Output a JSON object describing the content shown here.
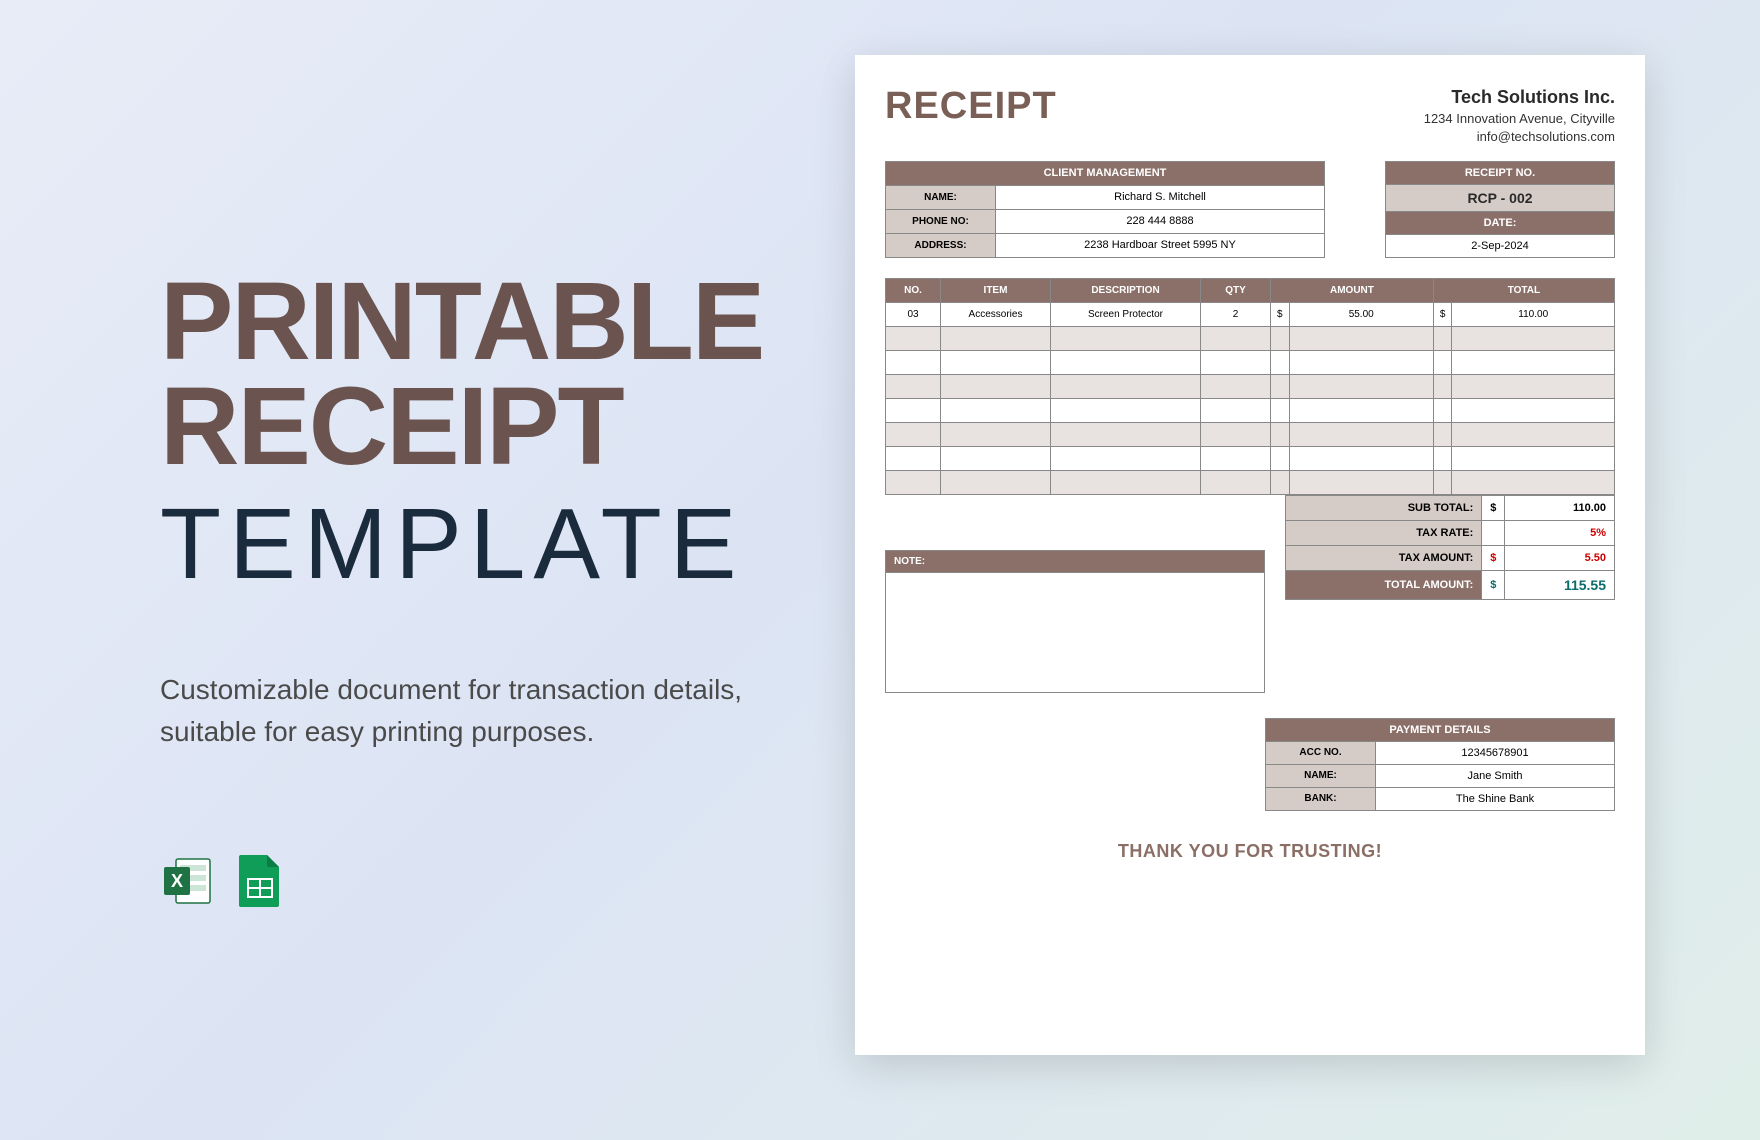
{
  "promo": {
    "title_line1": "PRINTABLE",
    "title_line2": "RECEIPT",
    "title_line3": "TEMPLATE",
    "subtitle": "Customizable document for transaction details, suitable for easy printing purposes."
  },
  "formats": {
    "excel": "Excel",
    "sheets": "Google Sheets"
  },
  "receipt": {
    "heading": "RECEIPT",
    "company": {
      "name": "Tech Solutions Inc.",
      "address": "1234 Innovation Avenue, Cityville",
      "email": "info@techsolutions.com"
    },
    "client": {
      "header": "CLIENT MANAGEMENT",
      "name_label": "NAME:",
      "name": "Richard S. Mitchell",
      "phone_label": "PHONE NO:",
      "phone": "228 444 8888",
      "address_label": "ADDRESS:",
      "address": "2238 Hardboar Street 5995 NY"
    },
    "meta": {
      "no_header": "RECEIPT NO.",
      "no": "RCP - 002",
      "date_header": "DATE:",
      "date": "2-Sep-2024"
    },
    "columns": {
      "no": "NO.",
      "item": "ITEM",
      "desc": "DESCRIPTION",
      "qty": "QTY",
      "amount": "AMOUNT",
      "total": "TOTAL"
    },
    "items": [
      {
        "no": "03",
        "item": "Accessories",
        "desc": "Screen Protector",
        "qty": "2",
        "amount_sym": "$",
        "amount": "55.00",
        "total_sym": "$",
        "total": "110.00"
      }
    ],
    "blank_rows": 7,
    "note_header": "NOTE:",
    "totals": {
      "subtotal_label": "SUB TOTAL:",
      "subtotal_sym": "$",
      "subtotal": "110.00",
      "taxrate_label": "TAX RATE:",
      "taxrate": "5%",
      "taxamount_label": "TAX AMOUNT:",
      "taxamount_sym": "$",
      "taxamount": "5.50",
      "total_label": "TOTAL AMOUNT:",
      "total_sym": "$",
      "total": "115.55"
    },
    "payment": {
      "header": "PAYMENT DETAILS",
      "acc_label": "ACC NO.",
      "acc": "12345678901",
      "name_label": "NAME:",
      "name": "Jane Smith",
      "bank_label": "BANK:",
      "bank": "The Shine Bank"
    },
    "thankyou": "THANK YOU FOR TRUSTING!"
  }
}
